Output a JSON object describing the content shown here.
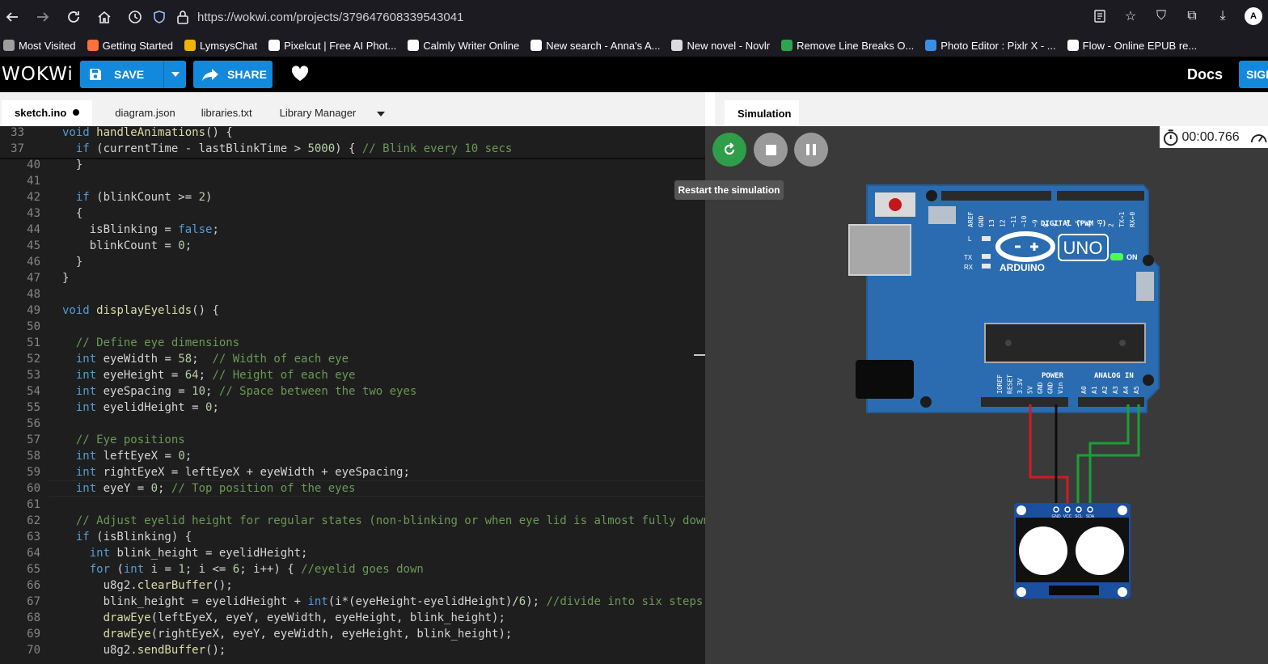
{
  "browser": {
    "url": "https://wokwi.com/projects/379647608339543041",
    "avatar_letter": "A",
    "bookmarks": [
      {
        "label": "Most Visited",
        "color": "#9e9e9e"
      },
      {
        "label": "Getting Started",
        "color": "#ff7139"
      },
      {
        "label": "LymsysChat",
        "color": "#f0b400"
      },
      {
        "label": "Pixelcut | Free AI Phot...",
        "color": "#ffffff"
      },
      {
        "label": "Calmly Writer Online",
        "color": "#ffffff"
      },
      {
        "label": "New search - Anna's A...",
        "color": "#ffffff"
      },
      {
        "label": "New novel - Novlr",
        "color": "#dcdcdc"
      },
      {
        "label": "Remove Line Breaks O...",
        "color": "#2ea44f"
      },
      {
        "label": "Photo Editor : Pixlr X - ...",
        "color": "#3a8ee6"
      },
      {
        "label": "Flow - Online EPUB re...",
        "color": "#ffffff"
      }
    ]
  },
  "header": {
    "logo": "WOKWi",
    "save_label": "SAVE",
    "share_label": "SHARE",
    "docs_label": "Docs",
    "signin_label": "SIGI"
  },
  "editor": {
    "tabs": [
      "sketch.ino",
      "diagram.json",
      "libraries.txt",
      "Library Manager"
    ],
    "active_tab": "sketch.ino",
    "current_line": 60
  },
  "simulation": {
    "tab_label": "Simulation",
    "timer": "00:00.766",
    "tooltip": "Restart the simulation",
    "colors": {
      "restart": "#2e9e4a",
      "control": "#9a9a9a",
      "board": "#2b6cb0"
    }
  },
  "board": {
    "brand": "ARDUINO",
    "model": "UNO",
    "on_label": "ON",
    "labels": {
      "digital": "DIGITAL (PWM ~)",
      "power": "POWER",
      "analog": "ANALOG IN",
      "aref": "AREF",
      "gnd": "GND",
      "l": "L",
      "tx": "TX",
      "rx": "RX"
    },
    "power_pins": [
      "IOREF",
      "RESET",
      "3.3V",
      "5V",
      "GND",
      "GND",
      "Vin"
    ],
    "analog_pins": [
      "A0",
      "A1",
      "A2",
      "A3",
      "A4",
      "A5"
    ],
    "digital_pins": [
      "13",
      "12",
      "~11",
      "~10",
      "~9",
      "8",
      "7",
      "~6",
      "~5",
      "4",
      "~3",
      "2",
      "TX→1",
      "RX←0"
    ]
  },
  "oled": {
    "pins": [
      "GND",
      "VCC",
      "SCL",
      "SDA"
    ]
  },
  "code_lines": [
    {
      "n": 33,
      "t": "void handleAnimations() {"
    },
    {
      "n": 37,
      "t": "  if (currentTime - lastBlinkTime > 5000) { // Blink every 10 secs"
    },
    {
      "n": 40,
      "t": "  }"
    },
    {
      "n": 41,
      "t": ""
    },
    {
      "n": 42,
      "t": "  if (blinkCount >= 2)"
    },
    {
      "n": 43,
      "t": "  {"
    },
    {
      "n": 44,
      "t": "    isBlinking = false;"
    },
    {
      "n": 45,
      "t": "    blinkCount = 0;"
    },
    {
      "n": 46,
      "t": "  }"
    },
    {
      "n": 47,
      "t": "}"
    },
    {
      "n": 48,
      "t": ""
    },
    {
      "n": 49,
      "t": "void displayEyelids() {"
    },
    {
      "n": 50,
      "t": ""
    },
    {
      "n": 51,
      "t": "  // Define eye dimensions"
    },
    {
      "n": 52,
      "t": "  int eyeWidth = 58;  // Width of each eye"
    },
    {
      "n": 53,
      "t": "  int eyeHeight = 64; // Height of each eye"
    },
    {
      "n": 54,
      "t": "  int eyeSpacing = 10; // Space between the two eyes"
    },
    {
      "n": 55,
      "t": "  int eyelidHeight = 0;"
    },
    {
      "n": 56,
      "t": ""
    },
    {
      "n": 57,
      "t": "  // Eye positions"
    },
    {
      "n": 58,
      "t": "  int leftEyeX = 0;"
    },
    {
      "n": 59,
      "t": "  int rightEyeX = leftEyeX + eyeWidth + eyeSpacing;"
    },
    {
      "n": 60,
      "t": "  int eyeY = 0; // Top position of the eyes"
    },
    {
      "n": 61,
      "t": ""
    },
    {
      "n": 62,
      "t": "  // Adjust eyelid height for regular states (non-blinking or when eye lid is almost fully down)"
    },
    {
      "n": 63,
      "t": "  if (isBlinking) {"
    },
    {
      "n": 64,
      "t": "    int blink_height = eyelidHeight;"
    },
    {
      "n": 65,
      "t": "    for (int i = 1; i <= 6; i++) { //eyelid goes down"
    },
    {
      "n": 66,
      "t": "      u8g2.clearBuffer();"
    },
    {
      "n": 67,
      "t": "      blink_height = eyelidHeight + int(i*(eyeHeight-eyelidHeight)/6); //divide into six steps"
    },
    {
      "n": 68,
      "t": "      drawEye(leftEyeX, eyeY, eyeWidth, eyeHeight, blink_height);"
    },
    {
      "n": 69,
      "t": "      drawEye(rightEyeX, eyeY, eyeWidth, eyeHeight, blink_height);"
    },
    {
      "n": 70,
      "t": "      u8g2.sendBuffer();"
    }
  ]
}
